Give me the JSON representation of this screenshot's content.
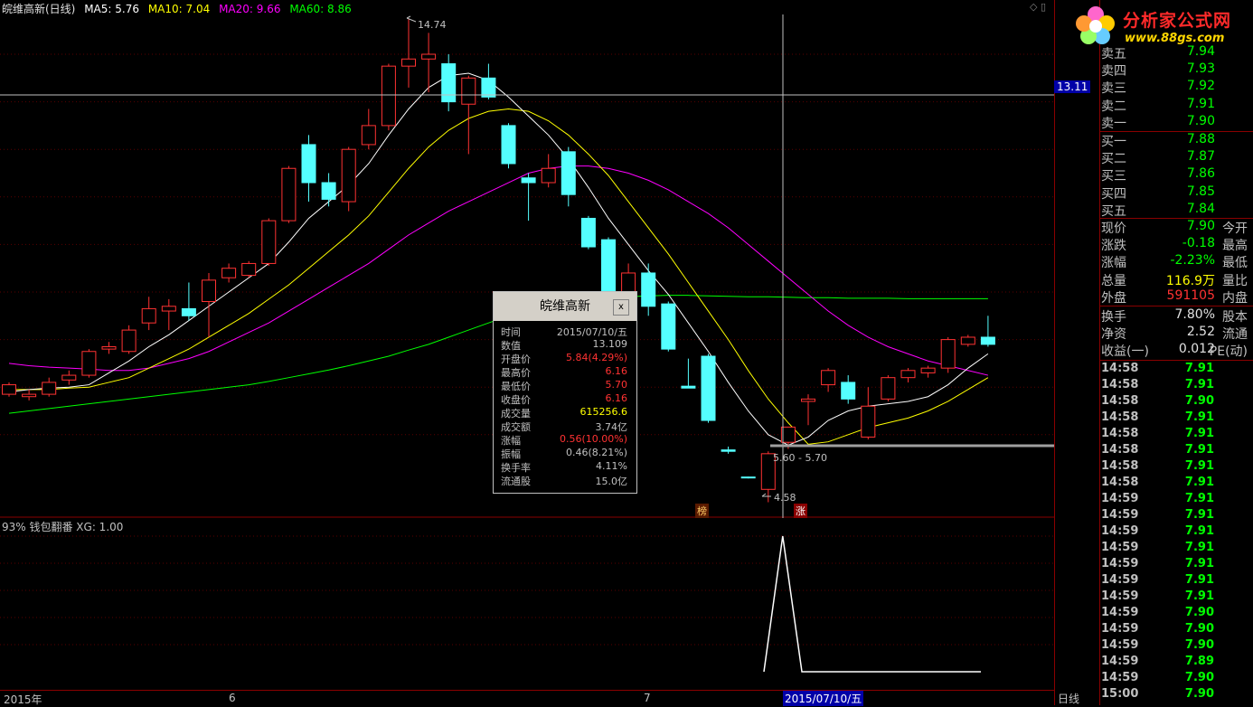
{
  "header": {
    "stock_name": "皖维高新(日线)",
    "ma5": "MA5: 5.76",
    "ma10": "MA10: 7.04",
    "ma20": "MA20: 9.66",
    "ma60": "MA60: 8.86",
    "colors": {
      "ma5": "#ffffff",
      "ma10": "#ffff00",
      "ma20": "#ff00ff",
      "ma60": "#00ff00"
    }
  },
  "chart_data": {
    "type": "candlestick",
    "y_ticks": [
      "14.00",
      "13.00",
      "12.00",
      "11.00",
      "10.00",
      "9.00",
      "8.00",
      "7.00",
      "6.00"
    ],
    "ylim": [
      4.0,
      15.0
    ],
    "high_label": "14.74",
    "low_label": "4.58",
    "range_label": "5.60 - 5.70",
    "crosshair_price": "13.11",
    "candles": [
      {
        "o": 6.85,
        "c": 7.05,
        "h": 7.1,
        "l": 6.8
      },
      {
        "o": 6.8,
        "c": 6.85,
        "h": 6.95,
        "l": 6.72
      },
      {
        "o": 6.85,
        "c": 7.1,
        "h": 7.2,
        "l": 6.8
      },
      {
        "o": 7.15,
        "c": 7.25,
        "h": 7.35,
        "l": 7.05
      },
      {
        "o": 7.25,
        "c": 7.75,
        "h": 7.8,
        "l": 7.2
      },
      {
        "o": 7.8,
        "c": 7.85,
        "h": 7.95,
        "l": 7.7
      },
      {
        "o": 7.75,
        "c": 8.2,
        "h": 8.3,
        "l": 7.7
      },
      {
        "o": 8.35,
        "c": 8.65,
        "h": 8.9,
        "l": 8.2
      },
      {
        "o": 8.6,
        "c": 8.7,
        "h": 8.85,
        "l": 8.2
      },
      {
        "o": 8.65,
        "c": 8.5,
        "h": 9.2,
        "l": 8.4
      },
      {
        "o": 8.8,
        "c": 9.25,
        "h": 9.4,
        "l": 8.05
      },
      {
        "o": 9.3,
        "c": 9.5,
        "h": 9.6,
        "l": 9.2
      },
      {
        "o": 9.35,
        "c": 9.6,
        "h": 9.65,
        "l": 9.3
      },
      {
        "o": 9.6,
        "c": 10.5,
        "h": 10.55,
        "l": 9.55
      },
      {
        "o": 10.5,
        "c": 11.6,
        "h": 11.65,
        "l": 10.45
      },
      {
        "o": 12.1,
        "c": 11.3,
        "h": 12.3,
        "l": 10.9
      },
      {
        "o": 11.3,
        "c": 10.95,
        "h": 11.5,
        "l": 10.8
      },
      {
        "o": 10.9,
        "c": 12.0,
        "h": 12.05,
        "l": 10.7
      },
      {
        "o": 12.1,
        "c": 12.5,
        "h": 12.85,
        "l": 12.0
      },
      {
        "o": 12.5,
        "c": 13.75,
        "h": 13.8,
        "l": 12.4
      },
      {
        "o": 13.75,
        "c": 13.9,
        "h": 14.74,
        "l": 13.3
      },
      {
        "o": 13.9,
        "c": 14.0,
        "h": 14.45,
        "l": 13.2
      },
      {
        "o": 13.8,
        "c": 13.0,
        "h": 14.0,
        "l": 12.8
      },
      {
        "o": 12.95,
        "c": 13.5,
        "h": 13.55,
        "l": 11.9
      },
      {
        "o": 13.5,
        "c": 13.1,
        "h": 13.8,
        "l": 13.05
      },
      {
        "o": 12.5,
        "c": 11.7,
        "h": 12.55,
        "l": 11.6
      },
      {
        "o": 11.4,
        "c": 11.3,
        "h": 11.5,
        "l": 10.5
      },
      {
        "o": 11.3,
        "c": 11.6,
        "h": 11.9,
        "l": 11.2
      },
      {
        "o": 11.95,
        "c": 11.05,
        "h": 12.05,
        "l": 10.8
      },
      {
        "o": 10.55,
        "c": 9.95,
        "h": 10.6,
        "l": 9.9
      },
      {
        "o": 10.1,
        "c": 8.95,
        "h": 10.15,
        "l": 8.9
      },
      {
        "o": 8.95,
        "c": 9.4,
        "h": 9.6,
        "l": 8.8
      },
      {
        "o": 9.4,
        "c": 8.7,
        "h": 9.6,
        "l": 8.5
      },
      {
        "o": 8.75,
        "c": 7.8,
        "h": 8.8,
        "l": 7.75
      },
      {
        "o": 7.02,
        "c": 6.98,
        "h": 7.6,
        "l": 6.98
      },
      {
        "o": 7.65,
        "c": 6.3,
        "h": 7.7,
        "l": 6.25
      },
      {
        "o": 5.68,
        "c": 5.65,
        "h": 5.75,
        "l": 5.6
      },
      {
        "o": 5.11,
        "c": 5.09,
        "h": 5.12,
        "l": 5.08
      },
      {
        "o": 4.85,
        "c": 5.6,
        "h": 5.65,
        "l": 4.58
      },
      {
        "o": 5.84,
        "c": 6.16,
        "h": 6.16,
        "l": 5.7
      },
      {
        "o": 6.7,
        "c": 6.75,
        "h": 6.85,
        "l": 6.2
      },
      {
        "o": 7.05,
        "c": 7.35,
        "h": 7.4,
        "l": 6.9
      },
      {
        "o": 7.1,
        "c": 6.75,
        "h": 7.25,
        "l": 6.65
      },
      {
        "o": 5.95,
        "c": 6.6,
        "h": 7.0,
        "l": 5.9
      },
      {
        "o": 6.75,
        "c": 7.2,
        "h": 7.25,
        "l": 6.7
      },
      {
        "o": 7.2,
        "c": 7.35,
        "h": 7.4,
        "l": 7.1
      },
      {
        "o": 7.3,
        "c": 7.4,
        "h": 7.45,
        "l": 7.2
      },
      {
        "o": 7.4,
        "c": 8.0,
        "h": 8.05,
        "l": 7.3
      },
      {
        "o": 7.9,
        "c": 8.05,
        "h": 8.1,
        "l": 7.85
      },
      {
        "o": 8.05,
        "c": 7.9,
        "h": 8.5,
        "l": 7.85
      }
    ],
    "ma5": [
      6.9,
      6.95,
      6.98,
      7.0,
      7.05,
      7.3,
      7.55,
      7.85,
      8.1,
      8.4,
      8.7,
      9.0,
      9.3,
      9.6,
      10.05,
      10.55,
      10.9,
      11.25,
      11.7,
      12.3,
      12.85,
      13.3,
      13.55,
      13.6,
      13.45,
      13.1,
      12.7,
      12.3,
      11.8,
      11.2,
      10.55,
      10.0,
      9.45,
      8.95,
      8.35,
      7.75,
      7.1,
      6.5,
      6.0,
      5.78,
      5.95,
      6.3,
      6.5,
      6.6,
      6.65,
      6.7,
      6.8,
      7.05,
      7.4,
      7.7
    ],
    "ma10": [
      6.95,
      6.95,
      6.95,
      6.98,
      7.0,
      7.1,
      7.2,
      7.4,
      7.6,
      7.8,
      8.05,
      8.3,
      8.55,
      8.85,
      9.15,
      9.5,
      9.85,
      10.2,
      10.6,
      11.1,
      11.6,
      12.05,
      12.4,
      12.65,
      12.8,
      12.85,
      12.8,
      12.6,
      12.3,
      11.9,
      11.45,
      10.9,
      10.35,
      9.8,
      9.2,
      8.6,
      8.0,
      7.35,
      6.75,
      6.25,
      5.8,
      5.85,
      6.0,
      6.15,
      6.25,
      6.35,
      6.5,
      6.7,
      6.95,
      7.2
    ],
    "ma20": [
      7.5,
      7.45,
      7.42,
      7.4,
      7.38,
      7.35,
      7.35,
      7.4,
      7.5,
      7.6,
      7.75,
      7.95,
      8.15,
      8.35,
      8.6,
      8.85,
      9.1,
      9.35,
      9.6,
      9.9,
      10.2,
      10.45,
      10.7,
      10.9,
      11.1,
      11.3,
      11.5,
      11.6,
      11.65,
      11.65,
      11.6,
      11.5,
      11.35,
      11.15,
      10.9,
      10.65,
      10.35,
      10.0,
      9.65,
      9.3,
      8.95,
      8.6,
      8.3,
      8.05,
      7.85,
      7.7,
      7.55,
      7.45,
      7.35,
      7.25
    ],
    "ma60": [
      6.45,
      6.5,
      6.55,
      6.6,
      6.65,
      6.7,
      6.75,
      6.8,
      6.85,
      6.9,
      6.95,
      7.0,
      7.05,
      7.12,
      7.2,
      7.28,
      7.36,
      7.45,
      7.55,
      7.65,
      7.78,
      7.9,
      8.05,
      8.2,
      8.35,
      8.5,
      8.6,
      8.7,
      8.78,
      8.84,
      8.88,
      8.9,
      8.92,
      8.93,
      8.93,
      8.92,
      8.91,
      8.9,
      8.9,
      8.89,
      8.88,
      8.88,
      8.87,
      8.87,
      8.87,
      8.86,
      8.86,
      8.86,
      8.86,
      8.86
    ]
  },
  "indicator": {
    "title": "93% 钱包翻番  XG: 1.00",
    "y_ticks": [
      "1.00",
      "0.80",
      "0.60",
      "0.40",
      "0.20"
    ],
    "signal_index": 38
  },
  "axis_labels": {
    "x1": "2015年",
    "x2": "6",
    "x3": "7"
  },
  "date_badge": "2015/07/10/五",
  "daily_label": "日线",
  "event_badges": [
    {
      "text": "榜"
    },
    {
      "text": "涨"
    }
  ],
  "popup": {
    "title": "皖维高新",
    "close": "x",
    "rows": [
      {
        "k": "时间",
        "v": "2015/07/10/五",
        "color": "#c0c0c0"
      },
      {
        "k": "数值",
        "v": "13.109",
        "color": "#c0c0c0"
      },
      {
        "k": "开盘价",
        "v": "5.84(4.29%)",
        "color": "#ff3232"
      },
      {
        "k": "最高价",
        "v": "6.16",
        "color": "#ff3232"
      },
      {
        "k": "最低价",
        "v": "5.70",
        "color": "#ff3232"
      },
      {
        "k": "收盘价",
        "v": "6.16",
        "color": "#ff3232"
      },
      {
        "k": "成交量",
        "v": "615256.6",
        "color": "#ffff00"
      },
      {
        "k": "成交额",
        "v": "3.74亿",
        "color": "#c0c0c0"
      },
      {
        "k": "涨幅",
        "v": "0.56(10.00%)",
        "color": "#ff3232"
      },
      {
        "k": "振幅",
        "v": "0.46(8.21%)",
        "color": "#c0c0c0"
      },
      {
        "k": "换手率",
        "v": "4.11%",
        "color": "#c0c0c0"
      },
      {
        "k": "流通股",
        "v": "15.0亿",
        "color": "#c0c0c0"
      }
    ]
  },
  "logo": {
    "text": "分析家公式网",
    "url": "www.88gs.com"
  },
  "quotes": {
    "sell": [
      {
        "label": "卖五",
        "price": "7.94"
      },
      {
        "label": "卖四",
        "price": "7.93"
      },
      {
        "label": "卖三",
        "price": "7.92"
      },
      {
        "label": "卖二",
        "price": "7.91"
      },
      {
        "label": "卖一",
        "price": "7.90"
      }
    ],
    "buy": [
      {
        "label": "买一",
        "price": "7.88"
      },
      {
        "label": "买二",
        "price": "7.87"
      },
      {
        "label": "买三",
        "price": "7.86"
      },
      {
        "label": "买四",
        "price": "7.85"
      },
      {
        "label": "买五",
        "price": "7.84"
      }
    ],
    "stats": [
      {
        "label": "现价",
        "value": "7.90",
        "color": "#00ff00",
        "label2": "今开"
      },
      {
        "label": "涨跌",
        "value": "-0.18",
        "color": "#00ff00",
        "label2": "最高"
      },
      {
        "label": "涨幅",
        "value": "-2.23%",
        "color": "#00ff00",
        "label2": "最低"
      },
      {
        "label": "总量",
        "value": "116.9万",
        "color": "#ffff00",
        "label2": "量比"
      },
      {
        "label": "外盘",
        "value": "591105",
        "color": "#ff3232",
        "label2": "内盘"
      }
    ],
    "stats2": [
      {
        "label": "换手",
        "value": "7.80%",
        "label2": "股本"
      },
      {
        "label": "净资",
        "value": "2.52",
        "label2": "流通"
      },
      {
        "label": "收益(一)",
        "value": "0.012",
        "label2": "PE(动)"
      }
    ]
  },
  "ticks": [
    {
      "t": "14:58",
      "p": "7.91"
    },
    {
      "t": "14:58",
      "p": "7.91"
    },
    {
      "t": "14:58",
      "p": "7.90"
    },
    {
      "t": "14:58",
      "p": "7.91"
    },
    {
      "t": "14:58",
      "p": "7.91"
    },
    {
      "t": "14:58",
      "p": "7.91"
    },
    {
      "t": "14:58",
      "p": "7.91"
    },
    {
      "t": "14:58",
      "p": "7.91"
    },
    {
      "t": "14:59",
      "p": "7.91"
    },
    {
      "t": "14:59",
      "p": "7.91"
    },
    {
      "t": "14:59",
      "p": "7.91"
    },
    {
      "t": "14:59",
      "p": "7.91"
    },
    {
      "t": "14:59",
      "p": "7.91"
    },
    {
      "t": "14:59",
      "p": "7.91"
    },
    {
      "t": "14:59",
      "p": "7.91"
    },
    {
      "t": "14:59",
      "p": "7.90"
    },
    {
      "t": "14:59",
      "p": "7.90"
    },
    {
      "t": "14:59",
      "p": "7.90"
    },
    {
      "t": "14:59",
      "p": "7.89"
    },
    {
      "t": "14:59",
      "p": "7.90"
    },
    {
      "t": "15:00",
      "p": "7.90"
    }
  ]
}
